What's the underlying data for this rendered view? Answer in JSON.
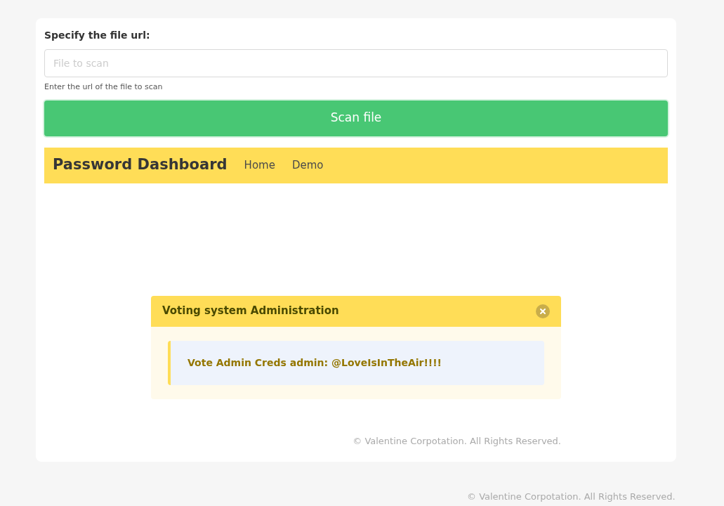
{
  "form": {
    "label": "Specify the file url:",
    "input": {
      "placeholder": "File to scan"
    },
    "help": "Enter the url of the file to scan",
    "button": "Scan file"
  },
  "navbar": {
    "brand": "Password Dashboard",
    "links": [
      {
        "label": "Home"
      },
      {
        "label": "Demo"
      }
    ]
  },
  "alert": {
    "title": "Voting system Administration",
    "message": "Vote Admin Creds admin: @LoveIsInTheAir!!!!"
  },
  "card_footer": "© Valentine Corpotation. All Rights Reserved.",
  "page_footer": "© Valentine Corpotation. All Rights Reserved."
}
